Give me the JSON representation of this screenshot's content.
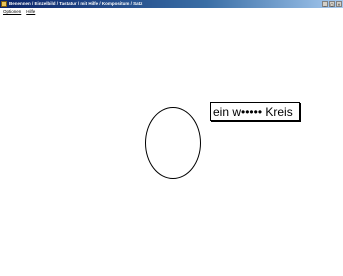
{
  "window": {
    "title": "Benennen / Einzelbild / Tastatur / mit Hilfe / Kompositum / Satz",
    "controls": [
      "_",
      "□",
      "×"
    ]
  },
  "menubar": {
    "items": [
      {
        "label": "Optionen"
      },
      {
        "label": "Hilfe"
      }
    ]
  },
  "canvas": {
    "shape": "circle",
    "label_text": "ein w••••• Kreis"
  },
  "colors": {
    "titlebar": "#0a246a",
    "background": "#ffffff",
    "stroke": "#000000"
  }
}
